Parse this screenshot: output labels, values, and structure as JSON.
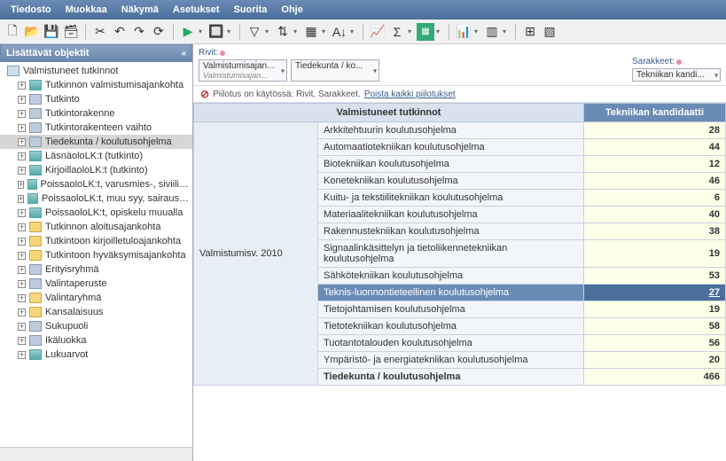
{
  "menu": {
    "items": [
      "Tiedosto",
      "Muokkaa",
      "Näkymä",
      "Asetukset",
      "Suorita",
      "Ohje"
    ]
  },
  "sidebar": {
    "title": "Lisättävät objektit",
    "root": "Valmistuneet tutkinnot",
    "items": [
      {
        "label": "Tutkinnon valmistumisajankohta",
        "icon": "bar"
      },
      {
        "label": "Tutkinto",
        "icon": "hier"
      },
      {
        "label": "Tutkintorakenne",
        "icon": "hier"
      },
      {
        "label": "Tutkintorakenteen vaihto",
        "icon": "hier"
      },
      {
        "label": "Tiedekunta / koulutusohjelma",
        "icon": "hier",
        "selected": true
      },
      {
        "label": "LäsnäoloLK:t (tutkinto)",
        "icon": "bar"
      },
      {
        "label": "KirjoillaoloLK:t (tutkinto)",
        "icon": "bar"
      },
      {
        "label": "PoissaoloLK:t, varusmies-, siviili…",
        "icon": "bar"
      },
      {
        "label": "PoissaoloLK:t, muu syy, sairaus…",
        "icon": "bar"
      },
      {
        "label": "PoissaoloLK:t, opiskelu muualla",
        "icon": "bar"
      },
      {
        "label": "Tutkinnon aloitusajankohta",
        "icon": "folder"
      },
      {
        "label": "Tutkintoon kirjoilletuloajankohta",
        "icon": "folder"
      },
      {
        "label": "Tutkintoon hyväksymisajankohta",
        "icon": "folder"
      },
      {
        "label": "Erityisryhmä",
        "icon": "hier"
      },
      {
        "label": "Valintaperuste",
        "icon": "hier"
      },
      {
        "label": "Valintaryhmä",
        "icon": "folder"
      },
      {
        "label": "Kansalaisuus",
        "icon": "folder"
      },
      {
        "label": "Sukupuoli",
        "icon": "hier"
      },
      {
        "label": "Ikäluokka",
        "icon": "hier"
      },
      {
        "label": "Lukuarvot",
        "icon": "bar"
      }
    ]
  },
  "axes": {
    "rows_label": "Rivit:",
    "cols_label": "Sarakkeet:",
    "row_chips": [
      {
        "main": "Valmistumisajan...",
        "sub": "Valmistumisajan..."
      },
      {
        "main": "Tiedekunta / ko...",
        "sub": ""
      }
    ],
    "col_chips": [
      {
        "main": "Tekniikan kandi...",
        "sub": ""
      }
    ]
  },
  "filter": {
    "text": "Piilotus on käytössä: Rivit, Sarakkeet.",
    "link": "Poista kaikki piilotukset"
  },
  "grid": {
    "header_main": "Valmistuneet tutkinnot",
    "header_col": "Tekniikan kandidaatti",
    "row_header": "Valmistumisv. 2010",
    "rows": [
      {
        "name": "Arkkitehtuurin koulutusohjelma",
        "value": "28"
      },
      {
        "name": "Automaatiotekniikan koulutusohjelma",
        "value": "44"
      },
      {
        "name": "Biotekniikan koulutusohjelma",
        "value": "12"
      },
      {
        "name": "Konetekniikan koulutusohjelma",
        "value": "46"
      },
      {
        "name": "Kuitu- ja tekstiilitekniikan koulutusohjelma",
        "value": "6"
      },
      {
        "name": "Materiaalitekniikan koulutusohjelma",
        "value": "40"
      },
      {
        "name": "Rakennustekniikan koulutusohjelma",
        "value": "38"
      },
      {
        "name": "Signaalinkäsittelyn ja tietoliikennetekniikan koulutusohjelma",
        "value": "19"
      },
      {
        "name": "Sähkötekniikan koulutusohjelma",
        "value": "53"
      },
      {
        "name": "Teknis-luonnontieteellinen koulutusohjelma",
        "value": "27",
        "highlight": true
      },
      {
        "name": "Tietojohtamisen koulutusohjelma",
        "value": "19"
      },
      {
        "name": "Tietotekniikan koulutusohjelma",
        "value": "58"
      },
      {
        "name": "Tuotantotalouden koulutusohjelma",
        "value": "56"
      },
      {
        "name": "Ympäristö- ja energiatekniikan koulutusohjelma",
        "value": "20"
      }
    ],
    "total": {
      "name": "Tiedekunta / koulutusohjelma",
      "value": "466"
    }
  }
}
